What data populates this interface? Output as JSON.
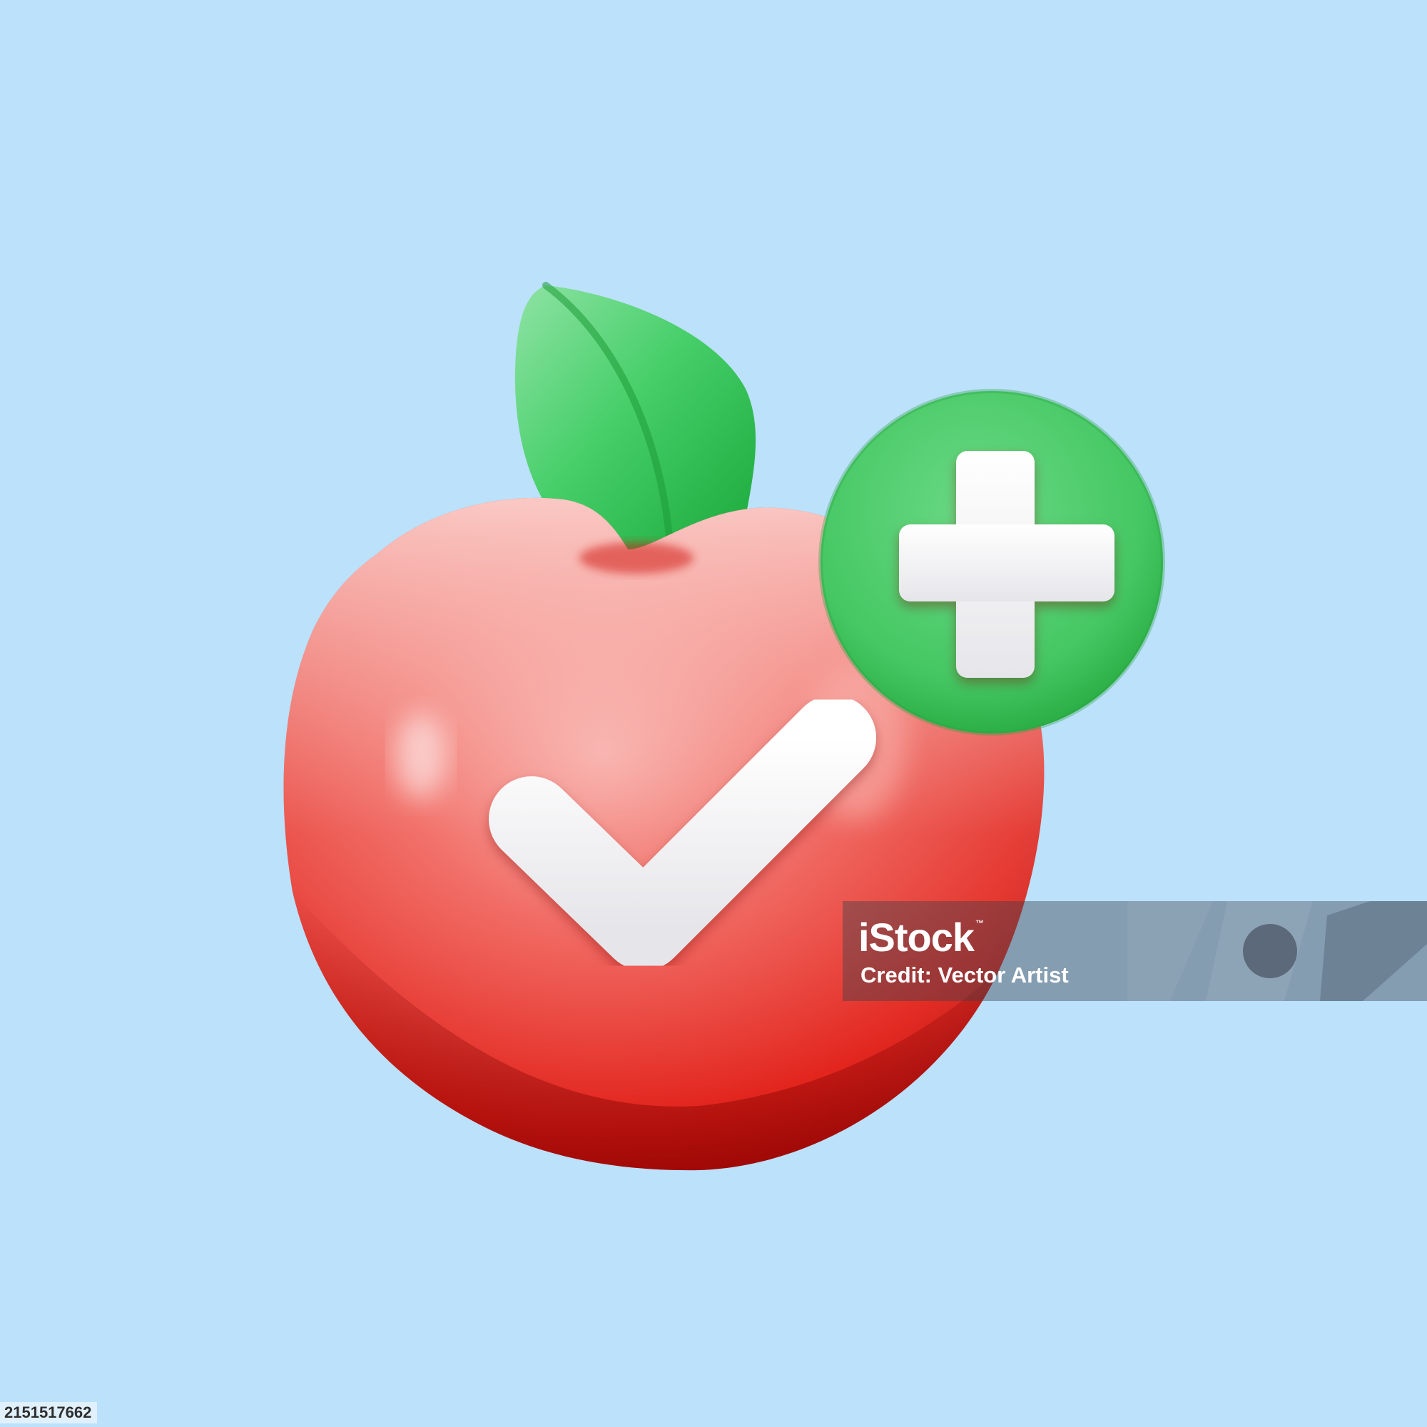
{
  "colors": {
    "background": "#bbe1fb",
    "apple_red": "#e5251c",
    "apple_highlight": "#f6a29c",
    "leaf_green": "#2fbf4c",
    "badge_green": "#47c865",
    "mark_white": "#ffffff"
  },
  "illustration": {
    "apple": {
      "badge_icon": "plus-icon",
      "body_icon": "checkmark-icon"
    }
  },
  "watermark": {
    "logo": "iStock",
    "trademark": "™",
    "credit": "Credit: Vector Artist"
  },
  "image_id": "2151517662"
}
